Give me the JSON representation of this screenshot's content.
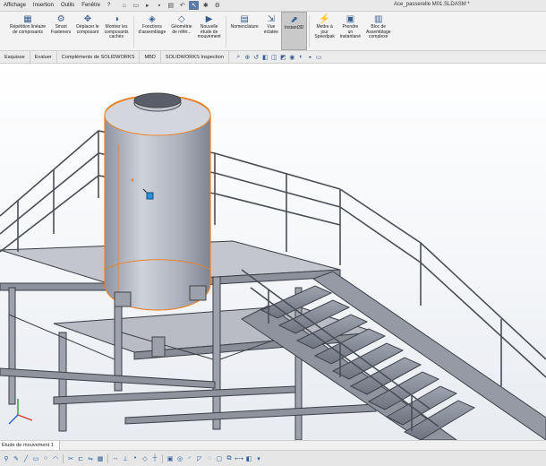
{
  "menu": {
    "items": [
      "Affichage",
      "Insertion",
      "Outils",
      "Fenêtre",
      "?"
    ]
  },
  "quick_access": {
    "icons": [
      "home-icon",
      "new-doc-icon",
      "open-icon",
      "save-icon",
      "print-icon",
      "undo-icon",
      "select-icon",
      "rebuild-icon",
      "options-icon"
    ]
  },
  "document": {
    "title": "Ace_passerelle M01.SLDASM *"
  },
  "ribbon": {
    "buttons": [
      {
        "label": "Répétition linéaire\nde composants",
        "icon": "linear-pattern-icon"
      },
      {
        "label": "Smart\nFasteners",
        "icon": "smart-fasteners-icon"
      },
      {
        "label": "Déplacer le\ncomposant",
        "icon": "move-component-icon"
      },
      {
        "label": "Montrer les\ncomposants\ncachés",
        "icon": "show-hidden-icon"
      },
      {
        "label": "Fonctions\nd'assemblage",
        "icon": "assembly-features-icon"
      },
      {
        "label": "Géométrie\nde référ...",
        "icon": "reference-geometry-icon"
      },
      {
        "label": "Nouvelle\nétude de\nmouvement",
        "icon": "motion-study-icon"
      },
      {
        "label": "Nomenclature",
        "icon": "bom-icon"
      },
      {
        "label": "Vue\néclatée",
        "icon": "exploded-view-icon"
      },
      {
        "label": "Instant3D",
        "icon": "instant3d-icon",
        "active": true
      },
      {
        "label": "Mettre à\njour\nSpeedpak",
        "icon": "speedpak-icon"
      },
      {
        "label": "Prendre\nun\ninstantané",
        "icon": "snapshot-icon"
      },
      {
        "label": "Bloc de\nAssemblage\ncomplexe",
        "icon": "large-assembly-icon"
      }
    ]
  },
  "tabs": [
    "Esquisse",
    "Evaluer",
    "Compléments de SOLIDWORKS",
    "MBD",
    "SOLIDWORKS Inspection"
  ],
  "bottom": {
    "motion_tab": "Étude de mouvement 1"
  },
  "colors": {
    "accent": "#3a5f8f",
    "selection": "#e8822a",
    "part": "#b8bcc8",
    "steel": "#9aa0ac"
  }
}
